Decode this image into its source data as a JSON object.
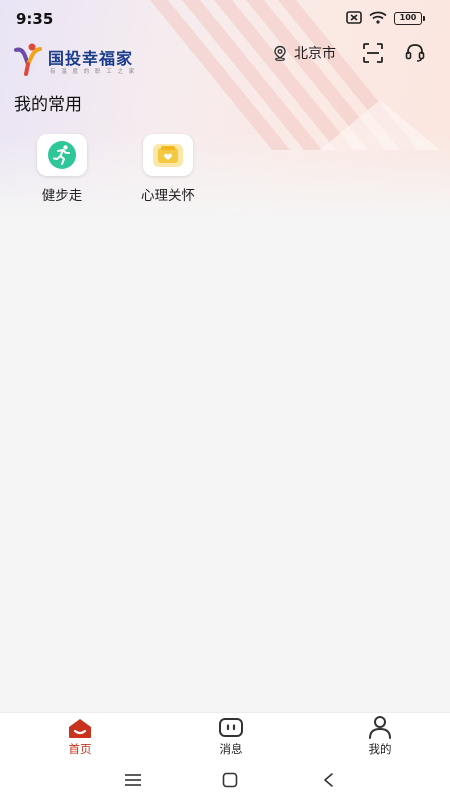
{
  "status_bar": {
    "time": "9:35",
    "battery_level": "100",
    "icons": [
      "sim-off-icon",
      "wifi-icon",
      "battery-icon"
    ]
  },
  "header": {
    "app_name": "国投幸福家",
    "tagline": "有 温 度 的 职 工 之 家",
    "location": "北京市",
    "icons": [
      "location-pin-icon",
      "scan-icon",
      "headset-icon"
    ]
  },
  "favorites": {
    "title": "我的常用",
    "items": [
      {
        "label": "健步走",
        "icon": "running-icon",
        "color": "#2fc79a"
      },
      {
        "label": "心理关怀",
        "icon": "heart-box-icon",
        "color": "#f5c842"
      }
    ]
  },
  "bottom_nav": {
    "items": [
      {
        "label": "首页",
        "icon": "home-icon",
        "active": true
      },
      {
        "label": "消息",
        "icon": "message-icon",
        "active": false
      },
      {
        "label": "我的",
        "icon": "profile-icon",
        "active": false
      }
    ],
    "active_color": "#c8331f"
  },
  "system_nav": {
    "icons": [
      "menu-icon",
      "home-square-icon",
      "back-icon"
    ]
  }
}
